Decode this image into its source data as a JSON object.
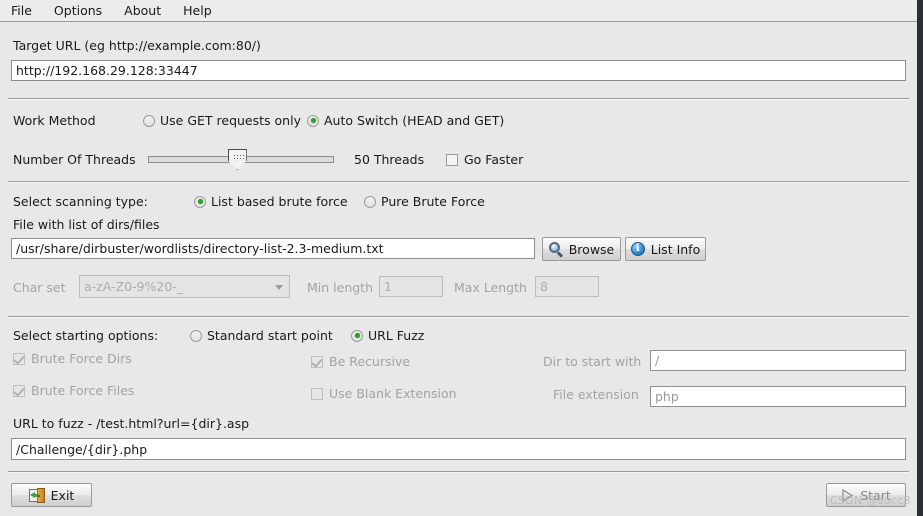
{
  "menubar": {
    "items": [
      {
        "label": "File"
      },
      {
        "label": "Options"
      },
      {
        "label": "About"
      },
      {
        "label": "Help"
      }
    ]
  },
  "target": {
    "label": "Target URL (eg http://example.com:80/)",
    "url_value": "http://192.168.29.128:33447"
  },
  "work_method": {
    "label": "Work Method",
    "option_get": "Use GET requests only",
    "option_auto": "Auto Switch (HEAD and GET)",
    "selected": "auto"
  },
  "threads": {
    "label": "Number Of Threads",
    "value_text": "50 Threads",
    "value": 50,
    "percent": 48,
    "go_faster_label": "Go Faster",
    "go_faster_checked": false
  },
  "scanning": {
    "label": "Select scanning type:",
    "option_list": "List based brute force",
    "option_pure": "Pure Brute Force",
    "selected": "list",
    "file_label": "File with list of dirs/files",
    "file_value": "/usr/share/dirbuster/wordlists/directory-list-2.3-medium.txt",
    "browse_label": "Browse",
    "browse_icon": "magnifier-icon",
    "list_info_label": "List Info",
    "list_info_icon": "info-circle-icon"
  },
  "charset": {
    "label": "Char set",
    "value": "a-zA-Z0-9%20-_",
    "min_label": "Min length",
    "min_value": "1",
    "max_label": "Max Length",
    "max_value": "8",
    "disabled": true
  },
  "starting": {
    "label": "Select starting options:",
    "option_standard": "Standard start point",
    "option_urlfuzz": "URL Fuzz",
    "selected": "urlfuzz",
    "brute_force_dirs": {
      "label": "Brute Force Dirs",
      "checked": true,
      "disabled": true
    },
    "brute_force_files": {
      "label": "Brute Force Files",
      "checked": true,
      "disabled": true
    },
    "be_recursive": {
      "label": "Be Recursive",
      "checked": true,
      "disabled": true
    },
    "use_blank_extension": {
      "label": "Use Blank Extension",
      "checked": false,
      "disabled": true
    },
    "dir_to_start_label": "Dir to start with",
    "dir_to_start_value": "/",
    "file_extension_label": "File extension",
    "file_extension_value": "php"
  },
  "url_fuzz": {
    "label": "URL to fuzz - /test.html?url={dir}.asp",
    "value": "/Challenge/{dir}.php"
  },
  "footer": {
    "exit_label": "Exit",
    "exit_icon": "exit-door-icon",
    "start_label": "Start",
    "start_icon": "play-triangle-icon",
    "watermark": "CSDN @succ3"
  },
  "colors": {
    "background": "#e8e8e8",
    "accent_green": "#33a02c",
    "frame_dark": "#2b2f38"
  }
}
